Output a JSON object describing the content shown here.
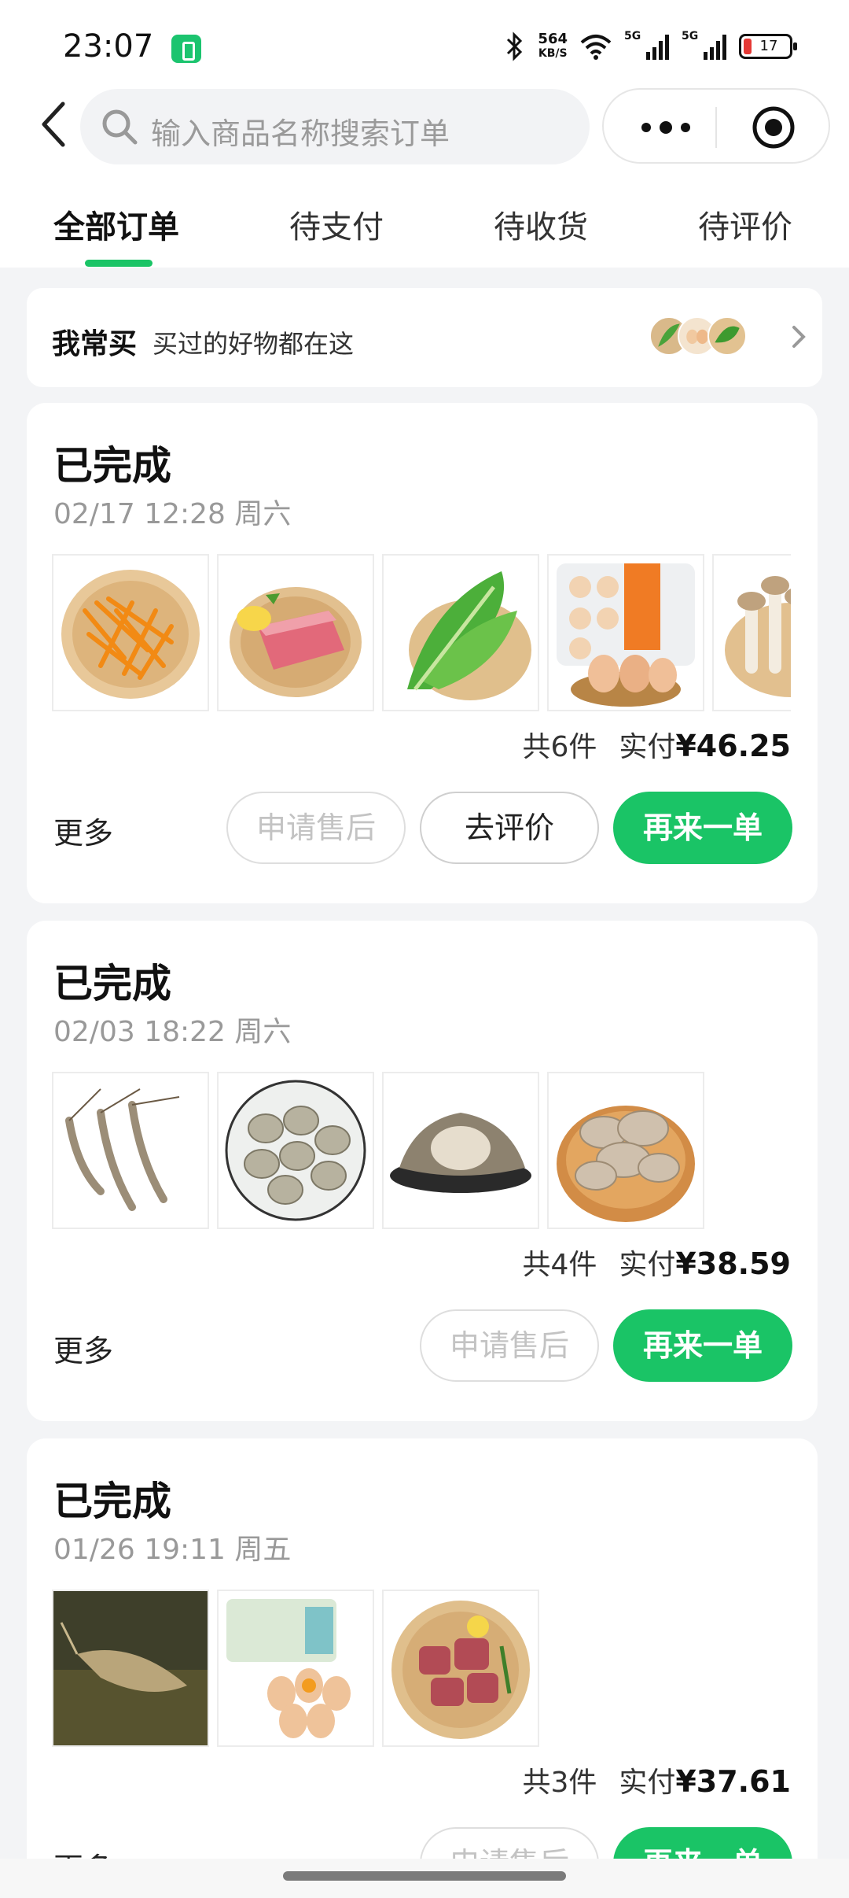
{
  "status_bar": {
    "time": "23:07",
    "net_speed_value": "564",
    "net_speed_unit": "KB/S",
    "signal1_label": "5G",
    "signal2_label": "5G",
    "battery_level": "17"
  },
  "header": {
    "search_placeholder": "输入商品名称搜索订单"
  },
  "tabs": [
    {
      "label": "全部订单",
      "active": true
    },
    {
      "label": "待支付",
      "active": false
    },
    {
      "label": "待收货",
      "active": false
    },
    {
      "label": "待评价",
      "active": false
    }
  ],
  "frequent": {
    "title": "我常买",
    "subtitle": "买过的好物都在这"
  },
  "orders": [
    {
      "status": "已完成",
      "date": "02/17 12:28 周六",
      "item_icons": [
        "carrot-shreds-icon",
        "pork-loin-icon",
        "lettuce-icon",
        "egg-box-icon",
        "mushroom-icon"
      ],
      "count_text": "共6件",
      "paid_label": "实付",
      "amount": "¥46.25",
      "more_label": "更多",
      "buttons": {
        "after_sale": "申请售后",
        "review": "去评价",
        "reorder": "再来一单"
      }
    },
    {
      "status": "已完成",
      "date": "02/03 18:22 周六",
      "item_icons": [
        "shrimp-icon",
        "clams-icon",
        "oyster-icon",
        "oyster-mushroom-icon"
      ],
      "count_text": "共4件",
      "paid_label": "实付",
      "amount": "¥38.59",
      "more_label": "更多",
      "buttons": {
        "after_sale": "申请售后",
        "reorder": "再来一单"
      }
    },
    {
      "status": "已完成",
      "date": "01/26 19:11 周五",
      "item_icons": [
        "live-shrimp-icon",
        "eggs-icon",
        "pork-ribs-icon"
      ],
      "count_text": "共3件",
      "paid_label": "实付",
      "amount": "¥37.61",
      "more_label": "更多",
      "buttons": {
        "after_sale": "申请售后",
        "reorder": "再来一单"
      }
    }
  ],
  "colors": {
    "accent": "#1ac466",
    "background": "#f3f4f6"
  }
}
